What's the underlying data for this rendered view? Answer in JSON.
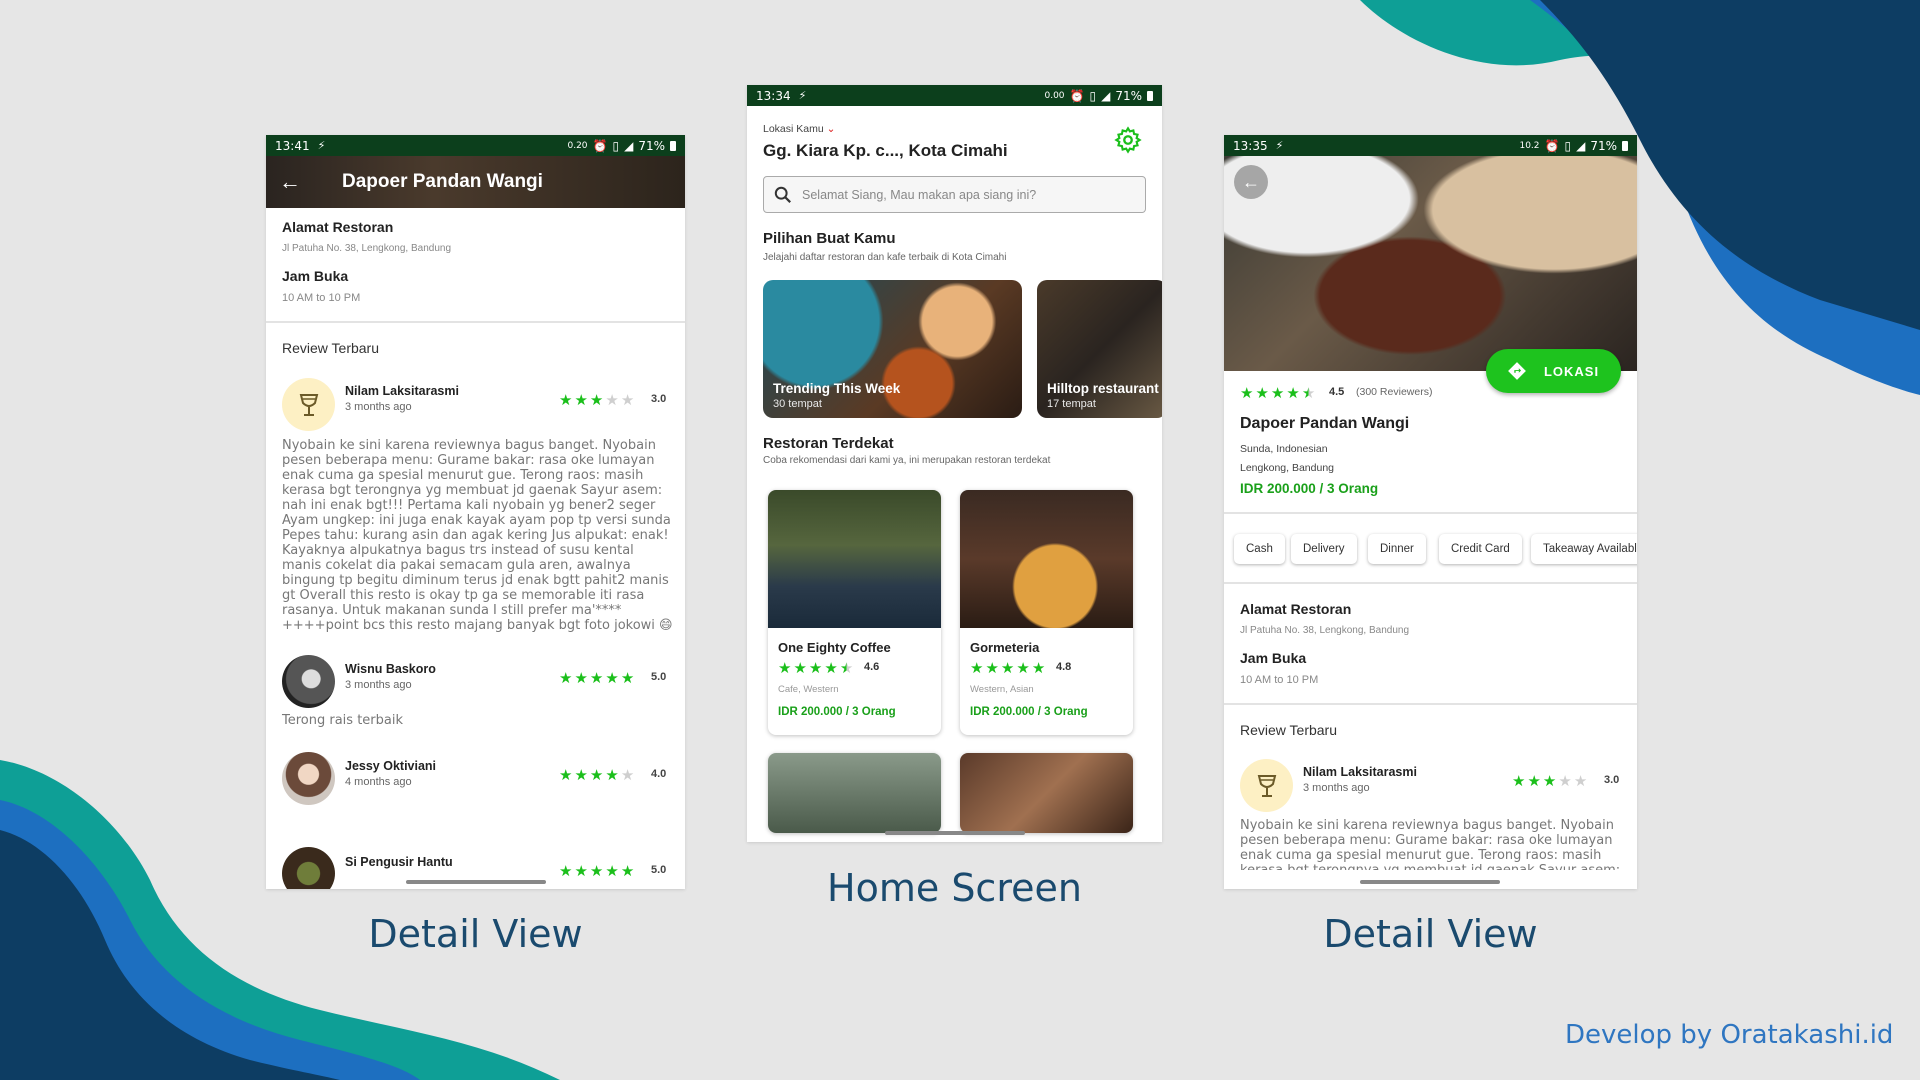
{
  "colors": {
    "brand_green": "#1bbf1b",
    "status_bar": "#0c3f1c",
    "caption_blue": "#1a4a6e",
    "credit_blue": "#2f76c1"
  },
  "captions": {
    "left": "Detail View",
    "middle": "Home Screen",
    "right": "Detail View"
  },
  "credit": "Develop by Oratakashi.id",
  "detail_left": {
    "status": {
      "time": "13:41",
      "speed": "0.20",
      "battery": "71%"
    },
    "title": "Dapoer Pandan Wangi",
    "address_heading": "Alamat Restoran",
    "address": "Jl Patuha No. 38, Lengkong, Bandung",
    "hours_heading": "Jam Buka",
    "hours": "10 AM to 10 PM",
    "reviews_heading": "Review Terbaru",
    "reviews": [
      {
        "name": "Nilam Laksitarasmi",
        "ago": "3 months ago",
        "rating": "3.0",
        "stars": 3,
        "text": "Nyobain ke sini karena reviewnya bagus banget. Nyobain pesen beberapa menu: Gurame bakar: rasa oke lumayan enak cuma ga spesial menurut gue.  Terong raos: masih kerasa bgt terongnya yg membuat jd gaenak Sayur asem: nah ini enak bgt!!! Pertama kali nyobain yg bener2 seger Ayam ungkep: ini juga enak kayak ayam pop tp versi sunda Pepes tahu: kurang asin dan agak kering Jus alpukat: enak! Kayaknya alpukatnya bagus trs instead of susu kental manis cokelat dia pakai semacam gula aren, awalnya bingung tp begitu diminum terus jd enak bgtt pahit2 manis gt  Overall this resto is okay tp ga se memorable iti rasa rasanya. Untuk makanan sunda I still prefer ma'**** ++++point bcs this resto majang banyak bgt foto jokowi 😄"
      },
      {
        "name": "Wisnu Baskoro",
        "ago": "3 months ago",
        "rating": "5.0",
        "stars": 5,
        "text": "Terong rais terbaik"
      },
      {
        "name": "Jessy Oktiviani",
        "ago": "4 months ago",
        "rating": "4.0",
        "stars": 4,
        "text": ""
      },
      {
        "name": "Si Pengusir Hantu",
        "ago": "",
        "rating": "5.0",
        "stars": 5,
        "text": ""
      }
    ]
  },
  "home": {
    "status": {
      "time": "13:34",
      "speed": "0.00",
      "battery": "71%"
    },
    "location_label": "Lokasi Kamu",
    "location": "Gg. Kiara Kp. c..., Kota Cimahi",
    "search_placeholder": "Selamat Siang, Mau makan apa siang ini?",
    "picks_heading": "Pilihan Buat Kamu",
    "picks_sub": "Jelajahi daftar restoran dan kafe terbaik di  Kota Cimahi",
    "collections": [
      {
        "title": "Trending This Week",
        "count": "30 tempat"
      },
      {
        "title": "Hilltop restaurant",
        "count": "17 tempat"
      }
    ],
    "nearby_heading": "Restoran Terdekat",
    "nearby_sub": "Coba rekomendasi dari kami ya, ini merupakan restoran terdekat",
    "restaurants": [
      {
        "name": "One Eighty Coffee",
        "rating": "4.6",
        "stars": 4.5,
        "category": "Cafe, Western",
        "price": "IDR 200.000 / 3 Orang"
      },
      {
        "name": "Gormeteria",
        "rating": "4.8",
        "stars": 5,
        "category": "Western, Asian",
        "price": "IDR 200.000 / 3 Orang"
      }
    ]
  },
  "detail_right": {
    "status": {
      "time": "13:35",
      "speed": "10.2",
      "battery": "71%"
    },
    "lokasi_button": "LOKASI",
    "rating": "4.5",
    "reviewers": "(300 Reviewers)",
    "name": "Dapoer Pandan Wangi",
    "cuisine": "Sunda, Indonesian",
    "area": "Lengkong, Bandung",
    "price": "IDR 200.000 / 3 Orang",
    "chips": [
      "Cash",
      "Delivery",
      "Dinner",
      "Credit Card",
      "Takeaway Available"
    ],
    "address_heading": "Alamat Restoran",
    "address": "Jl Patuha No. 38, Lengkong, Bandung",
    "hours_heading": "Jam Buka",
    "hours": "10 AM to 10 PM",
    "reviews_heading": "Review Terbaru",
    "review": {
      "name": "Nilam Laksitarasmi",
      "ago": "3 months ago",
      "rating": "3.0",
      "stars": 3,
      "text": "Nyobain ke sini karena reviewnya bagus banget. Nyobain pesen beberapa menu: Gurame bakar: rasa oke lumayan enak cuma ga spesial menurut gue.  Terong raos: masih kerasa bgt terongnya yg membuat jd gaenak Sayur asem:"
    }
  }
}
